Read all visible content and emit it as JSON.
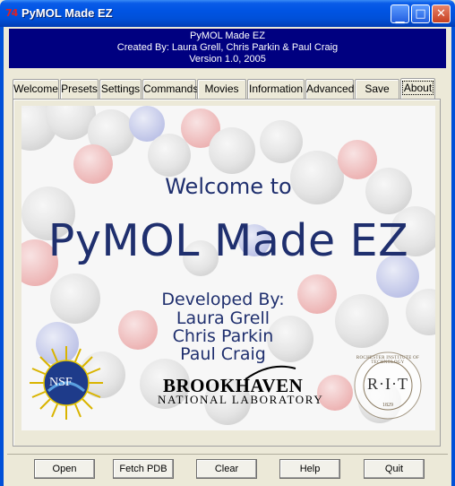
{
  "window": {
    "title": "PyMOL Made EZ",
    "icon_glyph": "74"
  },
  "banner": {
    "line1": "PyMOL Made EZ",
    "line2": "Created By: Laura Grell, Chris Parkin & Paul Craig",
    "line3": "Version 1.0, 2005"
  },
  "tabs": [
    {
      "label": "Welcome",
      "selected": false
    },
    {
      "label": "Presets",
      "selected": false
    },
    {
      "label": "Settings",
      "selected": false
    },
    {
      "label": "Commands",
      "selected": false
    },
    {
      "label": "Movies",
      "selected": false
    },
    {
      "label": "Information",
      "selected": false
    },
    {
      "label": "Advanced",
      "selected": false
    },
    {
      "label": "Save",
      "selected": false
    },
    {
      "label": "About",
      "selected": true
    }
  ],
  "welcome": {
    "welcome_to": "Welcome to",
    "title": "PyMOL Made EZ",
    "developed_by": "Developed By:",
    "developers": [
      "Laura Grell",
      "Chris Parkin",
      "Paul Craig"
    ],
    "nsf_logo": "NSF",
    "bnl_logo": "BROOKHAVEN",
    "bnl_sub": "NATIONAL LABORATORY",
    "rit_logo": "R·I·T",
    "rit_ring": "ROCHESTER INSTITUTE OF TECHNOLOGY",
    "rit_year": "1829"
  },
  "buttons": {
    "open": "Open",
    "fetch_pdb": "Fetch PDB",
    "clear": "Clear",
    "help": "Help",
    "quit": "Quit"
  },
  "colors": {
    "banner_bg": "#000080",
    "title_text": "#1f2f6e",
    "titlebar": "#0054e3"
  }
}
